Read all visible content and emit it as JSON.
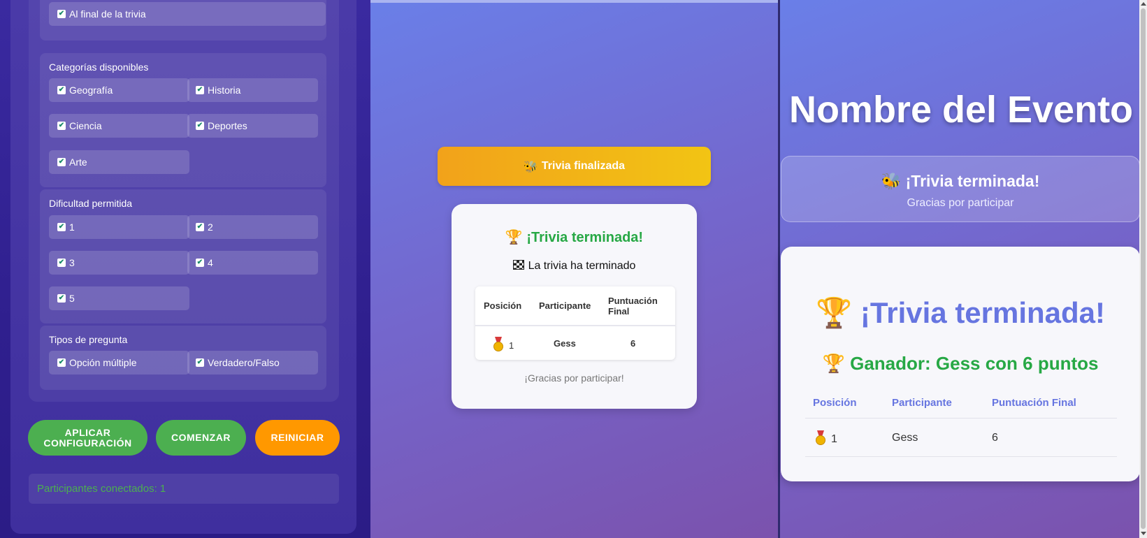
{
  "left_panel": {
    "when_group": {
      "option": "Al final de la trivia"
    },
    "categories": {
      "title": "Categorías disponibles",
      "options": [
        "Geografía",
        "Historia",
        "Ciencia",
        "Deportes",
        "Arte"
      ]
    },
    "difficulty": {
      "title": "Dificultad permitida",
      "options": [
        "1",
        "2",
        "3",
        "4",
        "5"
      ]
    },
    "question_types": {
      "title": "Tipos de pregunta",
      "options": [
        "Opción múltiple",
        "Verdadero/Falso"
      ]
    },
    "buttons": {
      "apply_line1": "APLICAR",
      "apply_line2": "CONFIGURACIÓN",
      "start": "COMENZAR",
      "reset": "REINICIAR"
    },
    "status": "Participantes conectados: 1",
    "check_glyph": "✔"
  },
  "middle_panel": {
    "finished_banner": "Trivia finalizada",
    "card_title": "¡Trivia terminada!",
    "card_subtitle": "La trivia ha terminado",
    "table": {
      "headers": [
        "Posición",
        "Participante",
        "Puntuación",
        "Final"
      ],
      "row": {
        "position": "1",
        "participant": "Gess",
        "score": "6"
      }
    },
    "thanks": "¡Gracias por participar!"
  },
  "right_panel": {
    "event_name": "Nombre del Evento",
    "banner_title": "¡Trivia terminada!",
    "banner_subtitle": "Gracias por participar",
    "card_title": "¡Trivia terminada!",
    "winner": "Ganador: Gess con 6 puntos",
    "table": {
      "headers": [
        "Posición",
        "Participante",
        "Puntuación Final"
      ],
      "row": {
        "position": "1",
        "participant": "Gess",
        "score": "6"
      }
    }
  },
  "icons": {
    "trophy": "🏆",
    "bee": "🐝",
    "medal": "medal-icon",
    "flag": "checkered-flag-icon"
  },
  "colors": {
    "accent_green": "#4caf50",
    "accent_orange": "#ff9800",
    "title_green": "#27a845",
    "title_blue": "#6675e0",
    "banner_gold": "#f2b416"
  }
}
